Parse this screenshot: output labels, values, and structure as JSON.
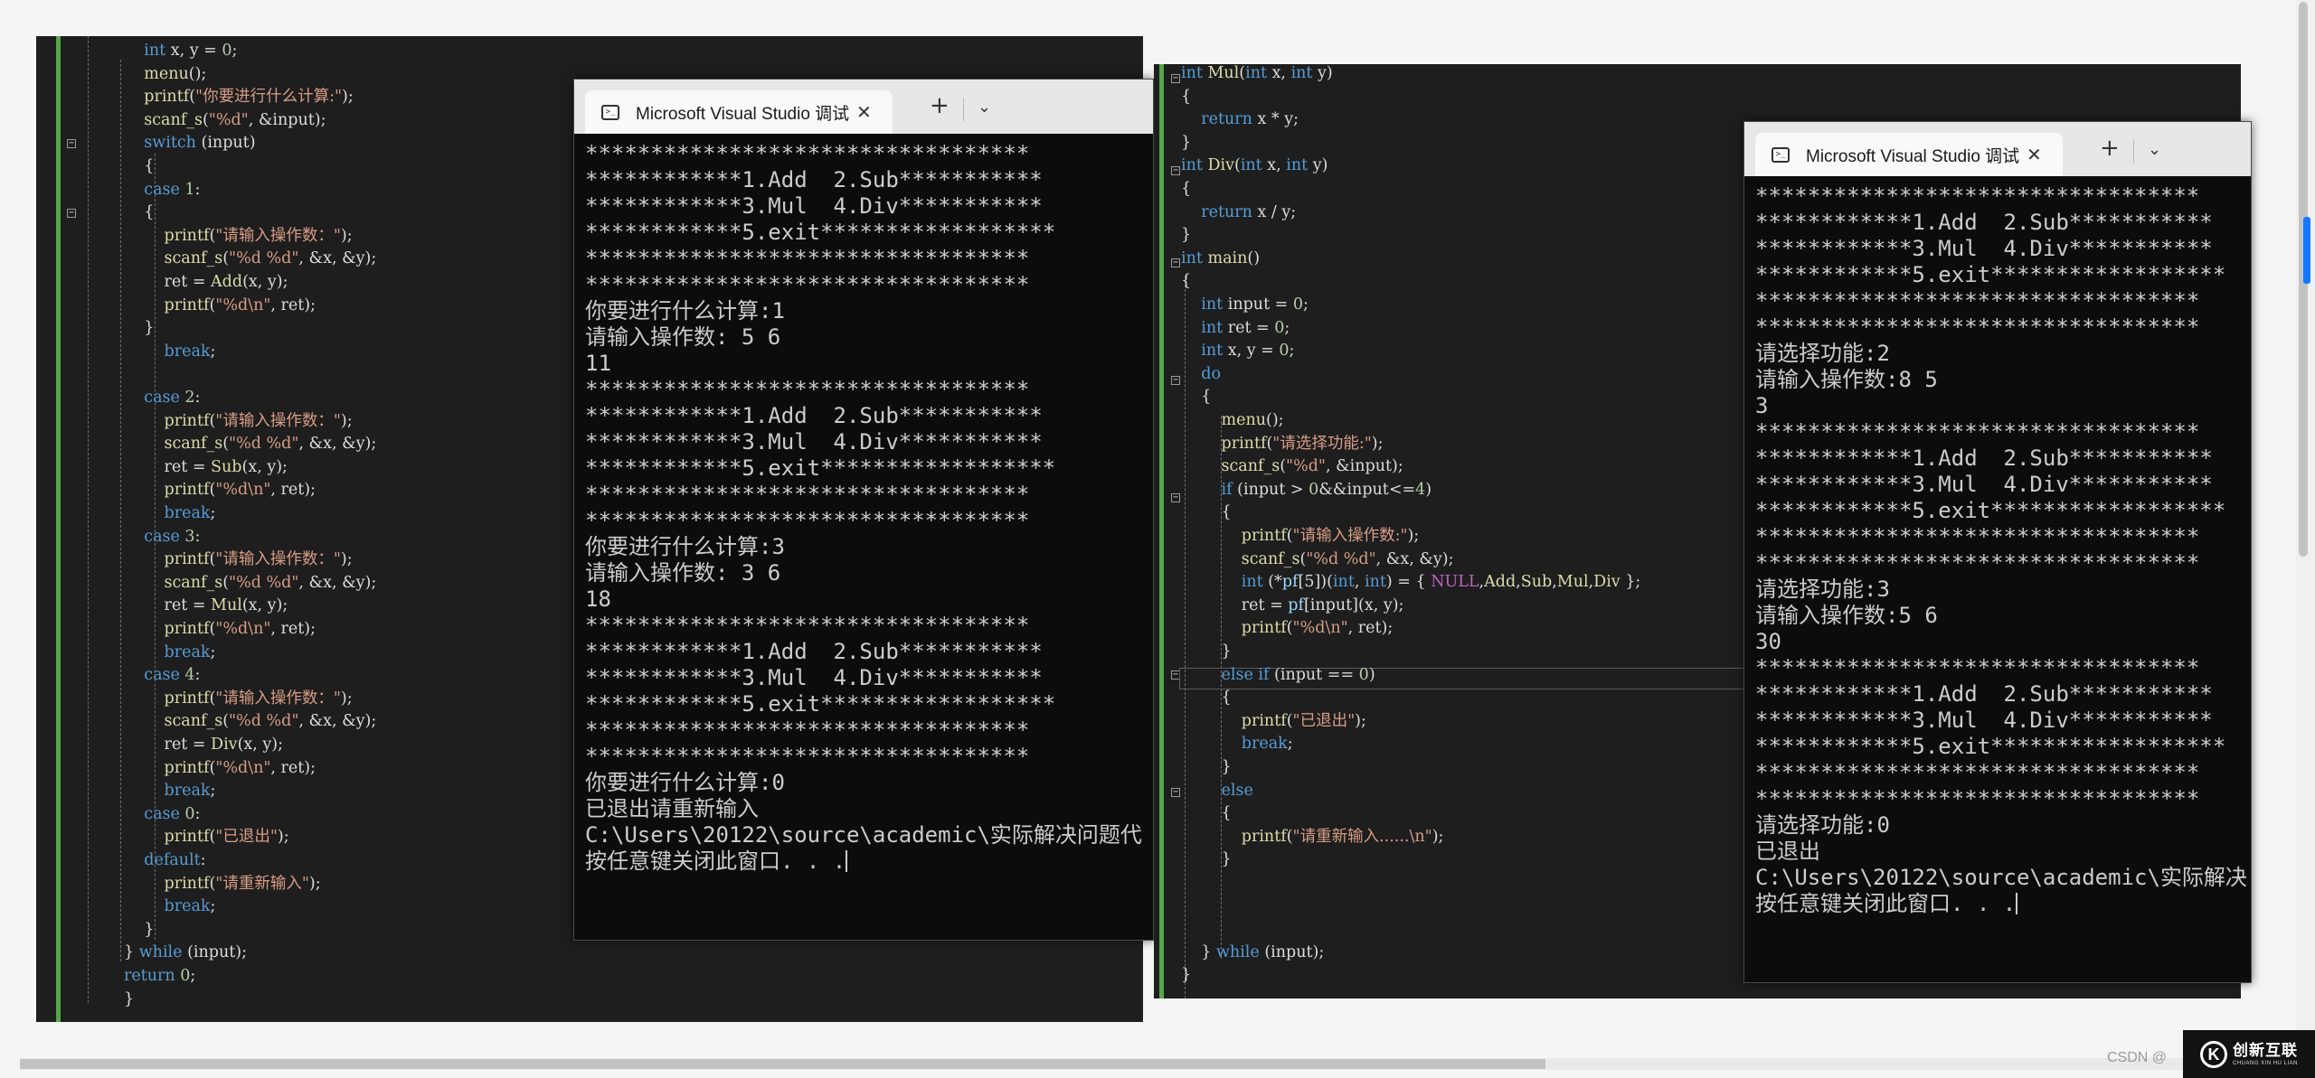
{
  "left_editor": {
    "lines": [
      [
        [
          "    int ",
          "k"
        ],
        [
          "x, y = ",
          "p"
        ],
        [
          "0",
          "n"
        ],
        [
          ";",
          "p"
        ]
      ],
      [
        [
          "    ",
          "p"
        ],
        [
          "menu",
          "f"
        ],
        [
          "();",
          "p"
        ]
      ],
      [
        [
          "    ",
          "p"
        ],
        [
          "printf",
          "f"
        ],
        [
          "(",
          "p"
        ],
        [
          "\"你要进行什么计算:\"",
          "s"
        ],
        [
          ");",
          "p"
        ]
      ],
      [
        [
          "    ",
          "p"
        ],
        [
          "scanf_s",
          "f"
        ],
        [
          "(",
          "p"
        ],
        [
          "\"%d\"",
          "s"
        ],
        [
          ", &input);",
          "p"
        ]
      ],
      [
        [
          "    ",
          "p"
        ],
        [
          "switch ",
          "k"
        ],
        [
          "(input)",
          "p"
        ]
      ],
      [
        [
          "    {",
          "p"
        ]
      ],
      [
        [
          "    ",
          "p"
        ],
        [
          "case ",
          "k"
        ],
        [
          "1",
          "n"
        ],
        [
          ":",
          "p"
        ]
      ],
      [
        [
          "    {",
          "p"
        ]
      ],
      [
        [
          "        ",
          "p"
        ],
        [
          "printf",
          "f"
        ],
        [
          "(",
          "p"
        ],
        [
          "\"请输入操作数：\"",
          "s"
        ],
        [
          ");",
          "p"
        ]
      ],
      [
        [
          "        ",
          "p"
        ],
        [
          "scanf_s",
          "f"
        ],
        [
          "(",
          "p"
        ],
        [
          "\"%d %d\"",
          "s"
        ],
        [
          ", &x, &y);",
          "p"
        ]
      ],
      [
        [
          "        ret = ",
          "p"
        ],
        [
          "Add",
          "f"
        ],
        [
          "(x, y);",
          "p"
        ]
      ],
      [
        [
          "        ",
          "p"
        ],
        [
          "printf",
          "f"
        ],
        [
          "(",
          "p"
        ],
        [
          "\"%d\\n\"",
          "s"
        ],
        [
          ", ret);",
          "p"
        ]
      ],
      [
        [
          "    }",
          "p"
        ]
      ],
      [
        [
          "        ",
          "p"
        ],
        [
          "break",
          "k"
        ],
        [
          ";",
          "p"
        ]
      ],
      [
        [
          "",
          "p"
        ]
      ],
      [
        [
          "    ",
          "p"
        ],
        [
          "case ",
          "k"
        ],
        [
          "2",
          "n"
        ],
        [
          ":",
          "p"
        ]
      ],
      [
        [
          "        ",
          "p"
        ],
        [
          "printf",
          "f"
        ],
        [
          "(",
          "p"
        ],
        [
          "\"请输入操作数：\"",
          "s"
        ],
        [
          ");",
          "p"
        ]
      ],
      [
        [
          "        ",
          "p"
        ],
        [
          "scanf_s",
          "f"
        ],
        [
          "(",
          "p"
        ],
        [
          "\"%d %d\"",
          "s"
        ],
        [
          ", &x, &y);",
          "p"
        ]
      ],
      [
        [
          "        ret = ",
          "p"
        ],
        [
          "Sub",
          "f"
        ],
        [
          "(x, y);",
          "p"
        ]
      ],
      [
        [
          "        ",
          "p"
        ],
        [
          "printf",
          "f"
        ],
        [
          "(",
          "p"
        ],
        [
          "\"%d\\n\"",
          "s"
        ],
        [
          ", ret);",
          "p"
        ]
      ],
      [
        [
          "        ",
          "p"
        ],
        [
          "break",
          "k"
        ],
        [
          ";",
          "p"
        ]
      ],
      [
        [
          "    ",
          "p"
        ],
        [
          "case ",
          "k"
        ],
        [
          "3",
          "n"
        ],
        [
          ":",
          "p"
        ]
      ],
      [
        [
          "        ",
          "p"
        ],
        [
          "printf",
          "f"
        ],
        [
          "(",
          "p"
        ],
        [
          "\"请输入操作数：\"",
          "s"
        ],
        [
          ");",
          "p"
        ]
      ],
      [
        [
          "        ",
          "p"
        ],
        [
          "scanf_s",
          "f"
        ],
        [
          "(",
          "p"
        ],
        [
          "\"%d %d\"",
          "s"
        ],
        [
          ", &x, &y);",
          "p"
        ]
      ],
      [
        [
          "        ret = ",
          "p"
        ],
        [
          "Mul",
          "f"
        ],
        [
          "(x, y);",
          "p"
        ]
      ],
      [
        [
          "        ",
          "p"
        ],
        [
          "printf",
          "f"
        ],
        [
          "(",
          "p"
        ],
        [
          "\"%d\\n\"",
          "s"
        ],
        [
          ", ret);",
          "p"
        ]
      ],
      [
        [
          "        ",
          "p"
        ],
        [
          "break",
          "k"
        ],
        [
          ";",
          "p"
        ]
      ],
      [
        [
          "    ",
          "p"
        ],
        [
          "case ",
          "k"
        ],
        [
          "4",
          "n"
        ],
        [
          ":",
          "p"
        ]
      ],
      [
        [
          "        ",
          "p"
        ],
        [
          "printf",
          "f"
        ],
        [
          "(",
          "p"
        ],
        [
          "\"请输入操作数：\"",
          "s"
        ],
        [
          ");",
          "p"
        ]
      ],
      [
        [
          "        ",
          "p"
        ],
        [
          "scanf_s",
          "f"
        ],
        [
          "(",
          "p"
        ],
        [
          "\"%d %d\"",
          "s"
        ],
        [
          ", &x, &y);",
          "p"
        ]
      ],
      [
        [
          "        ret = ",
          "p"
        ],
        [
          "Div",
          "f"
        ],
        [
          "(x, y);",
          "p"
        ]
      ],
      [
        [
          "        ",
          "p"
        ],
        [
          "printf",
          "f"
        ],
        [
          "(",
          "p"
        ],
        [
          "\"%d\\n\"",
          "s"
        ],
        [
          ", ret);",
          "p"
        ]
      ],
      [
        [
          "        ",
          "p"
        ],
        [
          "break",
          "k"
        ],
        [
          ";",
          "p"
        ]
      ],
      [
        [
          "    ",
          "p"
        ],
        [
          "case ",
          "k"
        ],
        [
          "0",
          "n"
        ],
        [
          ":",
          "p"
        ]
      ],
      [
        [
          "        ",
          "p"
        ],
        [
          "printf",
          "f"
        ],
        [
          "(",
          "p"
        ],
        [
          "\"已退出\"",
          "s"
        ],
        [
          ");",
          "p"
        ]
      ],
      [
        [
          "    ",
          "p"
        ],
        [
          "default",
          "k"
        ],
        [
          ":",
          "p"
        ]
      ],
      [
        [
          "        ",
          "p"
        ],
        [
          "printf",
          "f"
        ],
        [
          "(",
          "p"
        ],
        [
          "\"请重新输入\"",
          "s"
        ],
        [
          ");",
          "p"
        ]
      ],
      [
        [
          "        ",
          "p"
        ],
        [
          "break",
          "k"
        ],
        [
          ";",
          "p"
        ]
      ],
      [
        [
          "    }",
          "p"
        ]
      ],
      [
        [
          "} ",
          "p"
        ],
        [
          "while ",
          "k"
        ],
        [
          "(input);",
          "p"
        ]
      ],
      [
        [
          "",
          "p"
        ],
        [
          "return ",
          "k"
        ],
        [
          "0",
          "n"
        ],
        [
          ";",
          "p"
        ]
      ],
      [
        [
          "}",
          "p"
        ]
      ]
    ]
  },
  "right_editor": {
    "lines": [
      [
        [
          "int ",
          "k"
        ],
        [
          "Mul",
          "f"
        ],
        [
          "(",
          "p"
        ],
        [
          "int ",
          "k"
        ],
        [
          "x, ",
          "p"
        ],
        [
          "int ",
          "k"
        ],
        [
          "y)",
          "p"
        ]
      ],
      [
        [
          "{",
          "p"
        ]
      ],
      [
        [
          "    ",
          "p"
        ],
        [
          "return ",
          "k"
        ],
        [
          "x * y;",
          "p"
        ]
      ],
      [
        [
          "}",
          "p"
        ]
      ],
      [
        [
          "int ",
          "k"
        ],
        [
          "Div",
          "f"
        ],
        [
          "(",
          "p"
        ],
        [
          "int ",
          "k"
        ],
        [
          "x, ",
          "p"
        ],
        [
          "int ",
          "k"
        ],
        [
          "y)",
          "p"
        ]
      ],
      [
        [
          "{",
          "p"
        ]
      ],
      [
        [
          "    ",
          "p"
        ],
        [
          "return ",
          "k"
        ],
        [
          "x / y;",
          "p"
        ]
      ],
      [
        [
          "}",
          "p"
        ]
      ],
      [
        [
          "int ",
          "k"
        ],
        [
          "main",
          "f"
        ],
        [
          "()",
          "p"
        ]
      ],
      [
        [
          "{",
          "p"
        ]
      ],
      [
        [
          "    ",
          "p"
        ],
        [
          "int ",
          "k"
        ],
        [
          "input = ",
          "p"
        ],
        [
          "0",
          "n"
        ],
        [
          ";",
          "p"
        ]
      ],
      [
        [
          "    ",
          "p"
        ],
        [
          "int ",
          "k"
        ],
        [
          "ret = ",
          "p"
        ],
        [
          "0",
          "n"
        ],
        [
          ";",
          "p"
        ]
      ],
      [
        [
          "    ",
          "p"
        ],
        [
          "int ",
          "k"
        ],
        [
          "x, y = ",
          "p"
        ],
        [
          "0",
          "n"
        ],
        [
          ";",
          "p"
        ]
      ],
      [
        [
          "    ",
          "p"
        ],
        [
          "do",
          "k"
        ]
      ],
      [
        [
          "    {",
          "p"
        ]
      ],
      [
        [
          "        ",
          "p"
        ],
        [
          "menu",
          "f"
        ],
        [
          "();",
          "p"
        ]
      ],
      [
        [
          "        ",
          "p"
        ],
        [
          "printf",
          "f"
        ],
        [
          "(",
          "p"
        ],
        [
          "\"请选择功能:\"",
          "s"
        ],
        [
          ");",
          "p"
        ]
      ],
      [
        [
          "        ",
          "p"
        ],
        [
          "scanf_s",
          "f"
        ],
        [
          "(",
          "p"
        ],
        [
          "\"%d\"",
          "s"
        ],
        [
          ", &input);",
          "p"
        ]
      ],
      [
        [
          "        ",
          "p"
        ],
        [
          "if ",
          "k"
        ],
        [
          "(input > ",
          "p"
        ],
        [
          "0",
          "n"
        ],
        [
          "&&input<=",
          "p"
        ],
        [
          "4",
          "n"
        ],
        [
          ")",
          "p"
        ]
      ],
      [
        [
          "        {",
          "p"
        ]
      ],
      [
        [
          "            ",
          "p"
        ],
        [
          "printf",
          "f"
        ],
        [
          "(",
          "p"
        ],
        [
          "\"请输入操作数:\"",
          "s"
        ],
        [
          ");",
          "p"
        ]
      ],
      [
        [
          "            ",
          "p"
        ],
        [
          "scanf_s",
          "f"
        ],
        [
          "(",
          "p"
        ],
        [
          "\"%d %d\"",
          "s"
        ],
        [
          ", &x, &y);",
          "p"
        ]
      ],
      [
        [
          "            ",
          "p"
        ],
        [
          "int ",
          "k"
        ],
        [
          "(*",
          "p"
        ],
        [
          "pf",
          "v"
        ],
        [
          "[5])(",
          "p"
        ],
        [
          "int",
          "k"
        ],
        [
          ", ",
          "p"
        ],
        [
          "int",
          "k"
        ],
        [
          ") = { ",
          "p"
        ],
        [
          "NULL",
          "m"
        ],
        [
          ",",
          "p"
        ],
        [
          "Add",
          "f"
        ],
        [
          ",",
          "p"
        ],
        [
          "Sub",
          "f"
        ],
        [
          ",",
          "p"
        ],
        [
          "Mul",
          "f"
        ],
        [
          ",",
          "p"
        ],
        [
          "Div ",
          "f"
        ],
        [
          "};",
          "p"
        ]
      ],
      [
        [
          "            ret = ",
          "p"
        ],
        [
          "pf",
          "v"
        ],
        [
          "[input](x, y);",
          "p"
        ]
      ],
      [
        [
          "            ",
          "p"
        ],
        [
          "printf",
          "f"
        ],
        [
          "(",
          "p"
        ],
        [
          "\"%d\\n\"",
          "s"
        ],
        [
          ", ret);",
          "p"
        ]
      ],
      [
        [
          "        }",
          "p"
        ]
      ],
      [
        [
          "        ",
          "p"
        ],
        [
          "else if ",
          "k"
        ],
        [
          "(input == ",
          "p"
        ],
        [
          "0",
          "n"
        ],
        [
          ")",
          "p"
        ]
      ],
      [
        [
          "        {",
          "p"
        ]
      ],
      [
        [
          "            ",
          "p"
        ],
        [
          "printf",
          "f"
        ],
        [
          "(",
          "p"
        ],
        [
          "\"已退出\"",
          "s"
        ],
        [
          ");",
          "p"
        ]
      ],
      [
        [
          "            ",
          "p"
        ],
        [
          "break",
          "k"
        ],
        [
          ";",
          "p"
        ]
      ],
      [
        [
          "        }",
          "p"
        ]
      ],
      [
        [
          "        ",
          "p"
        ],
        [
          "else",
          "k"
        ]
      ],
      [
        [
          "        {",
          "p"
        ]
      ],
      [
        [
          "            ",
          "p"
        ],
        [
          "printf",
          "f"
        ],
        [
          "(",
          "p"
        ],
        [
          "\"请重新输入......\\n\"",
          "s"
        ],
        [
          ");",
          "p"
        ]
      ],
      [
        [
          "        }",
          "p"
        ]
      ],
      [
        [
          "",
          "p"
        ]
      ],
      [
        [
          "",
          "p"
        ]
      ],
      [
        [
          "",
          "p"
        ]
      ],
      [
        [
          "    } ",
          "p"
        ],
        [
          "while ",
          "k"
        ],
        [
          "(input);",
          "p"
        ]
      ],
      [
        [
          "}",
          "p"
        ]
      ]
    ]
  },
  "left_console": {
    "tab_title": "Microsoft Visual Studio 调试控制台",
    "close_symbol": "✕",
    "new_tab_symbol": "+",
    "dropdown_symbol": "⌄",
    "lines": [
      "**********************************",
      "************1.Add  2.Sub***********",
      "************3.Mul  4.Div***********",
      "************5.exit******************",
      "**********************************",
      "**********************************",
      "你要进行什么计算:1",
      "请输入操作数: 5 6",
      "11",
      "**********************************",
      "************1.Add  2.Sub***********",
      "************3.Mul  4.Div***********",
      "************5.exit******************",
      "**********************************",
      "**********************************",
      "你要进行什么计算:3",
      "请输入操作数: 3 6",
      "18",
      "**********************************",
      "************1.Add  2.Sub***********",
      "************3.Mul  4.Div***********",
      "************5.exit******************",
      "**********************************",
      "**********************************",
      "你要进行什么计算:0",
      "已退出请重新输入",
      "C:\\Users\\20122\\source\\academic\\实际解决问题代",
      "按任意键关闭此窗口. . ."
    ]
  },
  "right_console": {
    "tab_title": "Microsoft Visual Studio 调试控制台",
    "close_symbol": "✕",
    "new_tab_symbol": "+",
    "dropdown_symbol": "⌄",
    "lines": [
      "**********************************",
      "************1.Add  2.Sub***********",
      "************3.Mul  4.Div***********",
      "************5.exit******************",
      "**********************************",
      "**********************************",
      "请选择功能:2",
      "请输入操作数:8 5",
      "3",
      "**********************************",
      "************1.Add  2.Sub***********",
      "************3.Mul  4.Div***********",
      "************5.exit******************",
      "**********************************",
      "**********************************",
      "请选择功能:3",
      "请输入操作数:5 6",
      "30",
      "**********************************",
      "************1.Add  2.Sub***********",
      "************3.Mul  4.Div***********",
      "************5.exit******************",
      "**********************************",
      "**********************************",
      "请选择功能:0",
      "已退出",
      "C:\\Users\\20122\\source\\academic\\实际解决",
      "按任意键关闭此窗口. . ."
    ]
  },
  "footer": {
    "watermark": "CSDN @",
    "brand_name": "创新互联",
    "brand_sub": "CHUANG XIN HU LIAN",
    "brand_mark": "K"
  },
  "colors": {
    "editor_bg": "#1e1e1e",
    "console_bg": "#0c0c0c",
    "change_bar": "#57a64a",
    "scroll_marker": "#1677ff"
  }
}
